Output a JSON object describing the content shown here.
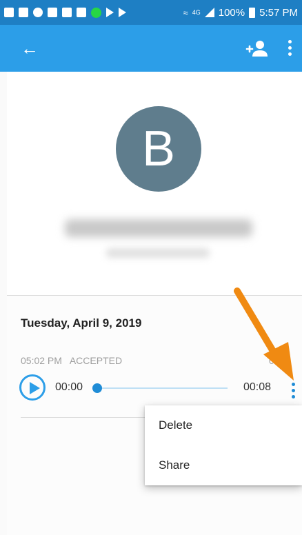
{
  "status_bar": {
    "battery_percent": "100%",
    "time": "5:57 PM",
    "network_label": "4G"
  },
  "app_bar": {
    "back_icon": "arrow-left-icon",
    "add_contact_icon": "person-add-icon",
    "more_icon": "more-vertical-icon"
  },
  "contact": {
    "avatar_initial": "B"
  },
  "call_log": {
    "date": "Tuesday, April 9, 2019",
    "time": "05:02 PM",
    "status": "ACCEPTED",
    "duration_partial": "0  4",
    "playback_start": "00:00",
    "playback_end": "00:08",
    "progress": 0
  },
  "context_menu": {
    "items": [
      "Delete",
      "Share"
    ]
  },
  "colors": {
    "status_bar": "#1e7fc4",
    "app_bar": "#2c9ee8",
    "avatar": "#5f7d8d",
    "accent": "#1f8cd6",
    "annotation_arrow": "#f08a12"
  }
}
